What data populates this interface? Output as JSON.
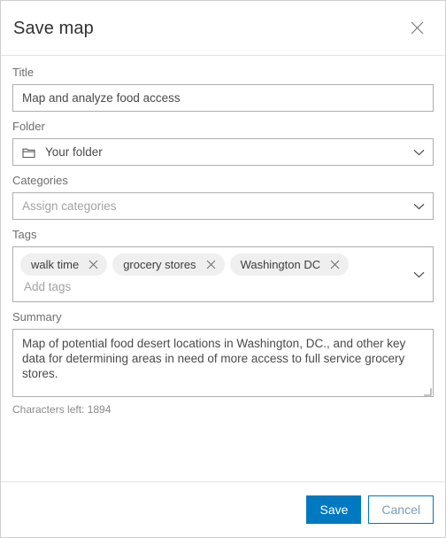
{
  "dialog": {
    "title": "Save map",
    "close_icon": "close-icon"
  },
  "fields": {
    "title": {
      "label": "Title",
      "value": "Map and analyze food access",
      "placeholder": "Title"
    },
    "folder": {
      "label": "Folder",
      "value": "Your folder",
      "icon": "folder-icon",
      "chevron": "chevron-down-icon"
    },
    "categories": {
      "label": "Categories",
      "value": "",
      "placeholder": "Assign categories",
      "chevron": "chevron-down-icon"
    },
    "tags": {
      "label": "Tags",
      "chips": [
        {
          "label": "walk time",
          "remove_icon": "close-icon"
        },
        {
          "label": "grocery stores",
          "remove_icon": "close-icon"
        },
        {
          "label": "Washington DC",
          "remove_icon": "close-icon"
        }
      ],
      "input_value": "",
      "placeholder": "Add tags",
      "chevron": "chevron-down-icon"
    },
    "summary": {
      "label": "Summary",
      "value": "Map of potential food desert locations in Washington, DC., and other key data for determining areas in need of more access to full service grocery stores.",
      "characters_left": "Characters left: 1894"
    }
  },
  "footer": {
    "save_label": "Save",
    "cancel_label": "Cancel"
  },
  "colors": {
    "accent": "#0079c1",
    "border": "#aeaeae",
    "chip_bg": "#efefef",
    "label_text": "#6e6e6e",
    "value_text": "#4a4a4a",
    "placeholder_text": "#a3a3a3"
  }
}
